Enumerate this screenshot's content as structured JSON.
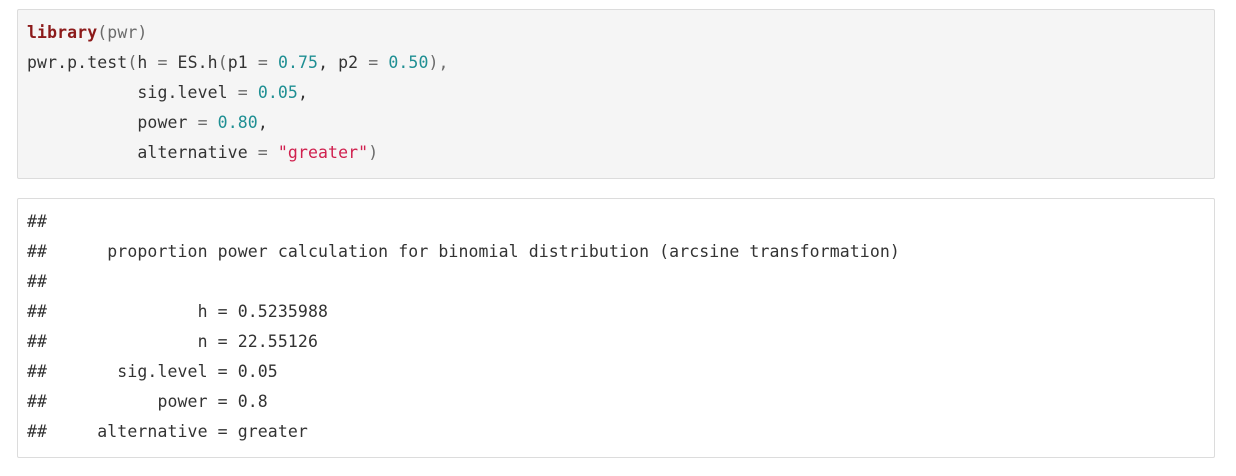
{
  "code": {
    "lines": [
      [
        {
          "t": "library",
          "c": "kw"
        },
        {
          "t": "(pwr)",
          "c": "op"
        }
      ],
      [
        {
          "t": "pwr.p.test",
          "c": "plain"
        },
        {
          "t": "(",
          "c": "op"
        },
        {
          "t": "h ",
          "c": "plain"
        },
        {
          "t": "=",
          "c": "op"
        },
        {
          "t": " ES.h",
          "c": "plain"
        },
        {
          "t": "(",
          "c": "op"
        },
        {
          "t": "p1 ",
          "c": "plain"
        },
        {
          "t": "=",
          "c": "op"
        },
        {
          "t": " ",
          "c": "plain"
        },
        {
          "t": "0.75",
          "c": "num"
        },
        {
          "t": ", p2 ",
          "c": "plain"
        },
        {
          "t": "=",
          "c": "op"
        },
        {
          "t": " ",
          "c": "plain"
        },
        {
          "t": "0.50",
          "c": "num"
        },
        {
          "t": "),",
          "c": "op"
        }
      ],
      [
        {
          "t": "           sig.level ",
          "c": "plain"
        },
        {
          "t": "=",
          "c": "op"
        },
        {
          "t": " ",
          "c": "plain"
        },
        {
          "t": "0.05",
          "c": "num"
        },
        {
          "t": ",",
          "c": "plain"
        }
      ],
      [
        {
          "t": "           power ",
          "c": "plain"
        },
        {
          "t": "=",
          "c": "op"
        },
        {
          "t": " ",
          "c": "plain"
        },
        {
          "t": "0.80",
          "c": "num"
        },
        {
          "t": ",",
          "c": "plain"
        }
      ],
      [
        {
          "t": "           alternative ",
          "c": "plain"
        },
        {
          "t": "=",
          "c": "op"
        },
        {
          "t": " ",
          "c": "plain"
        },
        {
          "t": "\"greater\"",
          "c": "str"
        },
        {
          "t": ")",
          "c": "op"
        }
      ]
    ]
  },
  "output": {
    "lines": [
      "##",
      "##      proportion power calculation for binomial distribution (arcsine transformation)",
      "##",
      "##               h = 0.5235988",
      "##               n = 22.55126",
      "##       sig.level = 0.05",
      "##           power = 0.8",
      "##     alternative = greater"
    ]
  }
}
